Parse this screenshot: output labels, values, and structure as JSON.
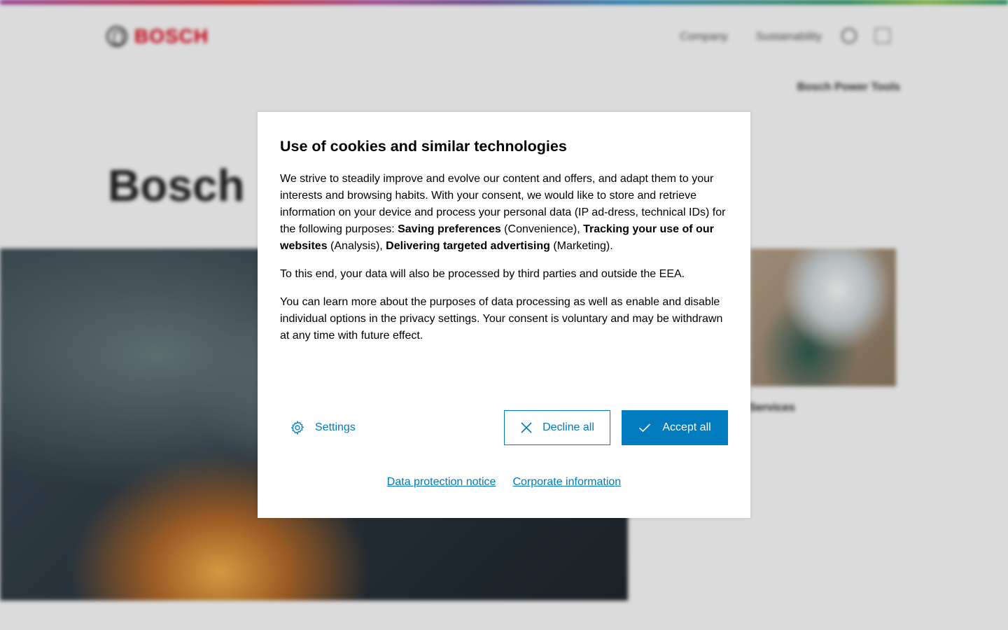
{
  "background": {
    "brand": "BOSCH",
    "nav": [
      "Company",
      "Sustainability"
    ],
    "sub_link": "Bosch Power Tools",
    "hero_title": "Bosch",
    "side_link": "Services",
    "brand_color": "#e20015"
  },
  "dialog": {
    "title": "Use of cookies and similar technologies",
    "p1_a": "We strive to steadily improve and evolve our content and offers, and adapt them to your interests and browsing habits. With your consent, we would like to store and retrieve information on your device and process your personal data (IP ad-dress, technical IDs) for the following purposes: ",
    "p1_b1": "Saving preferences",
    "p1_c": " (Convenience), ",
    "p1_b2": "Tracking your use of our websites",
    "p1_d": " (Analysis), ",
    "p1_b3": "Delivering targeted advertising",
    "p1_e": " (Marketing).",
    "p2": "To this end, your data will also be processed by third parties and outside the EEA.",
    "p3": "You can learn more about the purposes of data processing as well as enable and disable individual options in the privacy settings. Your consent is voluntary and may be withdrawn at any time with future effect.",
    "settings_label": "Settings",
    "decline_label": "Decline all",
    "accept_label": "Accept all",
    "link_data_protection": "Data protection notice",
    "link_corporate": "Corporate information",
    "accent_color": "#007bc0"
  }
}
